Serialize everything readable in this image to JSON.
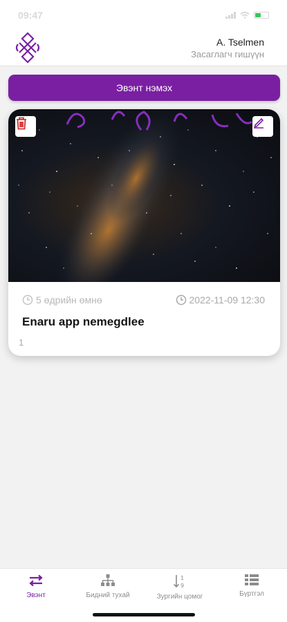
{
  "status_bar": {
    "time": "09:47"
  },
  "header": {
    "user_name": "A. Tselmen",
    "user_role": "Засаглагч гишүүн"
  },
  "actions": {
    "add_event_label": "Эвэнт нэмэх"
  },
  "event_card": {
    "relative_time": "5 өдрийн өмнө",
    "datetime": "2022-11-09 12:30",
    "title": "Enaru app nemegdlee",
    "count": "1"
  },
  "tabs": [
    {
      "label": "Эвэнт",
      "icon": "swap-arrows-icon",
      "active": true
    },
    {
      "label": "Бидний тухай",
      "icon": "org-chart-icon",
      "active": false
    },
    {
      "label": "Зургийн цомог",
      "icon": "sort-numeric-icon",
      "active": false
    },
    {
      "label": "Бүртгэл",
      "icon": "list-icon",
      "active": false
    }
  ],
  "colors": {
    "accent": "#7a1fa2",
    "delete": "#d32f2f",
    "background": "#f2f2f2"
  }
}
